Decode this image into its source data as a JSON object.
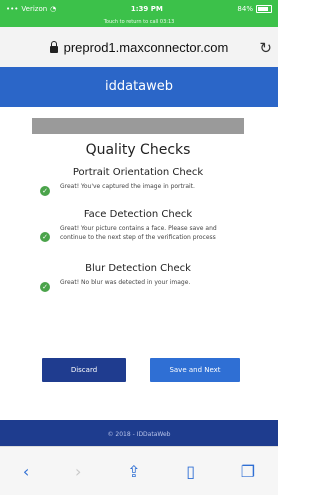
{
  "status_bar": {
    "carrier": "Verizon",
    "time": "1:39 PM",
    "battery_text": "84%",
    "call_banner": "Touch to return to call 03:13",
    "color": "#3cc14a"
  },
  "browser": {
    "url": "preprod1.maxconnector.com",
    "icons": {
      "lock": "lock-icon",
      "reload": "reload-icon"
    }
  },
  "header": {
    "title": "iddataweb",
    "color": "#2b66c8"
  },
  "page": {
    "title": "Quality Checks",
    "checks": [
      {
        "title": "Portrait Orientation Check",
        "message": "Great! You've captured the image in portrait."
      },
      {
        "title": "Face Detection Check",
        "message": "Great! Your picture contains a face. Please save and continue to the next step of the verification process"
      },
      {
        "title": "Blur Detection Check",
        "message": "Great! No blur was detected in your image."
      }
    ],
    "buttons": {
      "discard": "Discard",
      "save": "Save and Next"
    }
  },
  "footer": {
    "text": "© 2018 - IDDataWeb"
  },
  "toolbar": {
    "icons": [
      "back-icon",
      "forward-icon",
      "share-icon",
      "bookmarks-icon",
      "tabs-icon"
    ]
  }
}
